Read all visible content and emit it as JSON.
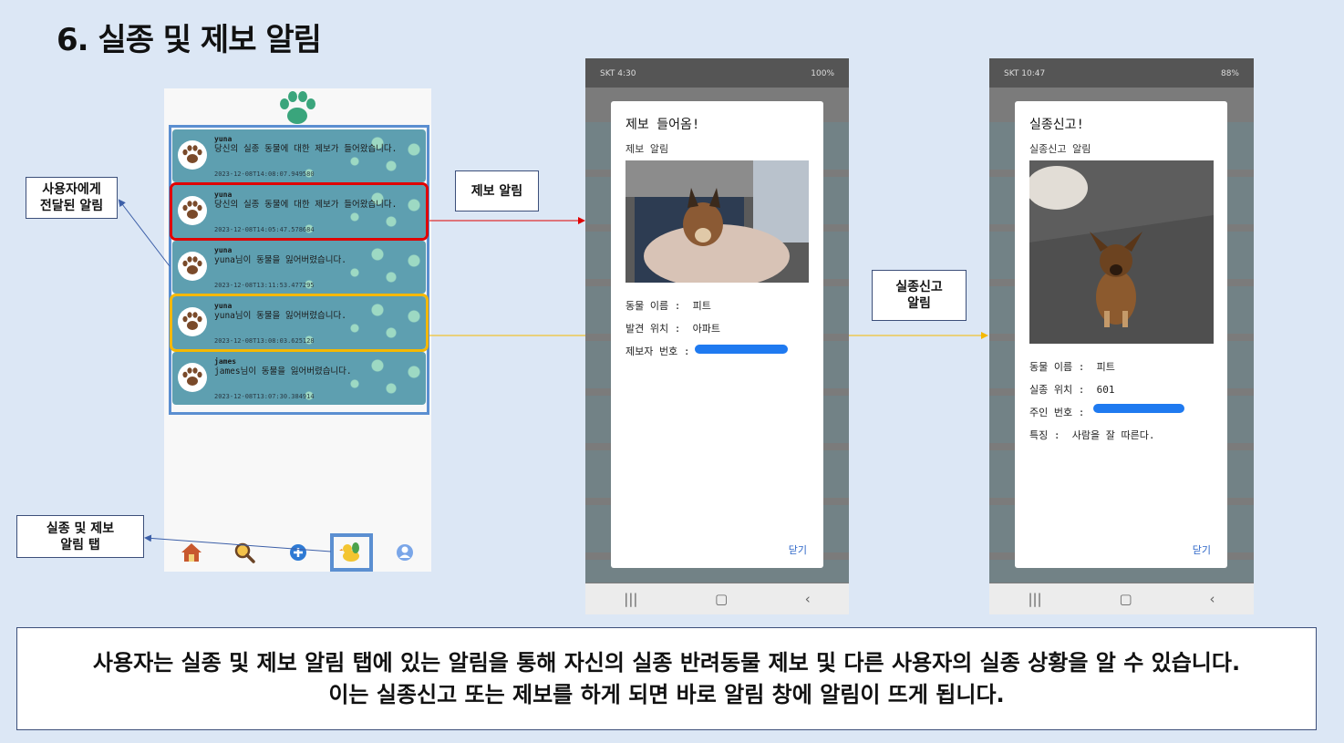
{
  "page": {
    "title": "6. 실종 및 제보 알림"
  },
  "notifications": [
    {
      "user": "yuna",
      "message": "당신의 실종 동물에 대한 제보가 들어왔습니다.",
      "time": "2023-12-08T14:08:07.949580"
    },
    {
      "user": "yuna",
      "message": "당신의 실종 동물에 대한 제보가 들어왔습니다.",
      "time": "2023-12-08T14:05:47.578684"
    },
    {
      "user": "yuna",
      "message": "yuna님이 동물을 잃어버렸습니다.",
      "time": "2023-12-08T13:11:53.477295"
    },
    {
      "user": "yuna",
      "message": "yuna님이 동물을 잃어버렸습니다.",
      "time": "2023-12-08T13:08:03.625128"
    },
    {
      "user": "james",
      "message": "james님이 동물을 잃어버렸습니다.",
      "time": "2023-12-08T13:07:30.384914"
    }
  ],
  "callouts": {
    "user_alert": "사용자에게\n전달된 알림",
    "tip_alert": "제보 알림",
    "missing_alert": "실종신고\n알림",
    "alert_tab": "실종 및 제보\n알림 탭"
  },
  "phone2": {
    "status_left": "SKT 4:30",
    "status_right": "100%",
    "dialog": {
      "title": "제보 들어옴!",
      "subtitle": "제보 알림",
      "fields": [
        {
          "label": "동물 이름 :",
          "value": "피트"
        },
        {
          "label": "발견 위치 :",
          "value": "아파트"
        },
        {
          "label": "제보자 번호 :",
          "value": ""
        }
      ],
      "close": "닫기"
    }
  },
  "phone3": {
    "status_left": "SKT 10:47",
    "status_right": "88%",
    "dialog": {
      "title": "실종신고!",
      "subtitle": "실종신고 알림",
      "fields": [
        {
          "label": "동물 이름 :",
          "value": "피트"
        },
        {
          "label": "실종 위치 :",
          "value": "601"
        },
        {
          "label": "주인 번호 :",
          "value": ""
        },
        {
          "label": "특징 :",
          "value": "사람을 잘 따른다."
        }
      ],
      "close": "닫기"
    }
  },
  "caption": {
    "line1": "사용자는 실종 및 제보 알림 탭에 있는 알림을 통해 자신의 실종 반려동물 제보 및 다른 사용자의 실종 상황을 알 수 있습니다.",
    "line2": "이는 실종신고 또는 제보를 하게 되면 바로 알림 창에 알림이 뜨게 됩니다."
  },
  "colors": {
    "accent": "#5b8fd1",
    "red": "#e00000",
    "yellow": "#f5b800",
    "teal": "#5e9fb0"
  }
}
